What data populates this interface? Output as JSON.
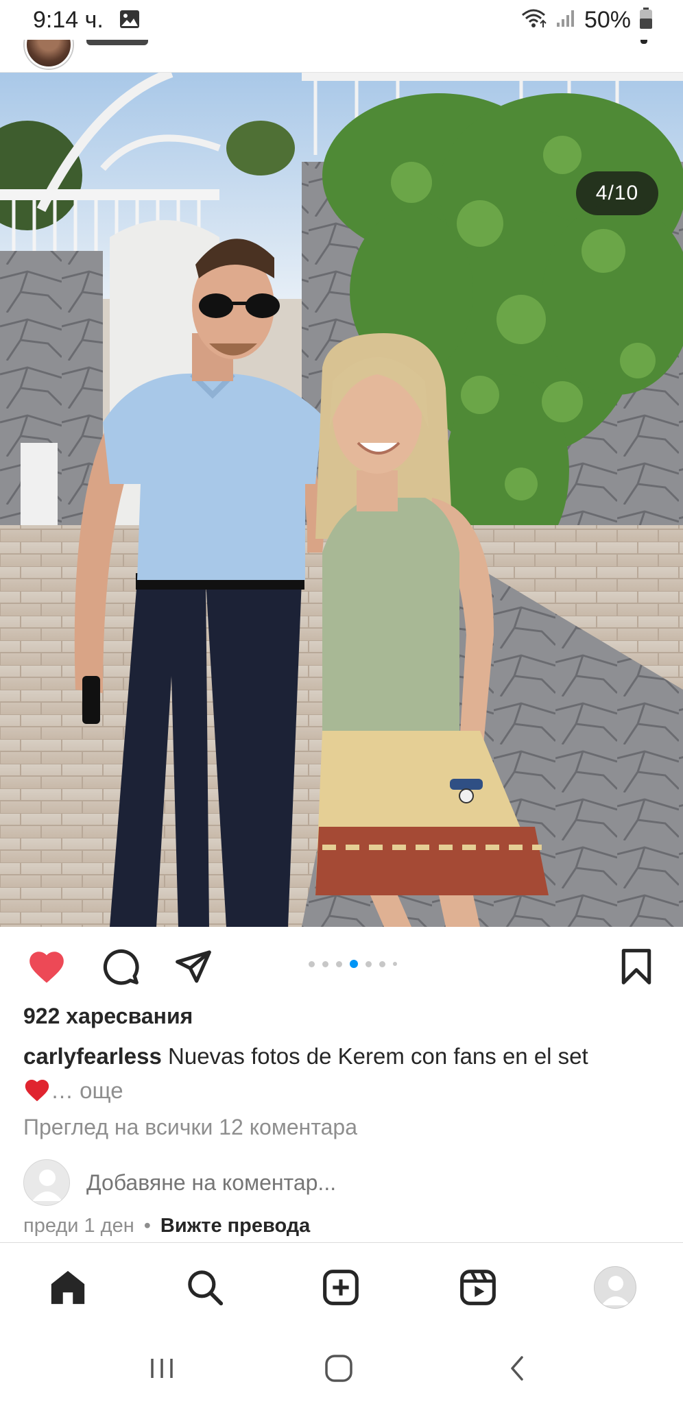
{
  "status_bar": {
    "time": "9:14 ч.",
    "battery_percent": "50%",
    "icons": [
      "gallery-icon",
      "wifi-icon",
      "signal-icon",
      "battery-icon"
    ]
  },
  "post": {
    "photo_counter": "4/10",
    "carousel": {
      "total_dots": 7,
      "active_index": 3
    },
    "likes": "922 харесвания",
    "caption_user": "carlyfearless",
    "caption_text": "Nuevas fotos de Kerem con fans en el set",
    "caption_more": "… още",
    "view_comments": "Преглед на всички 12 коментара",
    "add_comment_placeholder": "Добавяне на коментар...",
    "time_ago": "преди 1 ден",
    "separator": "•",
    "translate": "Вижте превода",
    "liked": true
  },
  "bottom_nav": {
    "items": [
      "home-icon",
      "search-icon",
      "create-icon",
      "reels-icon",
      "profile-avatar"
    ]
  },
  "system_nav": {
    "items": [
      "recent-apps-icon",
      "home-button-icon",
      "back-icon"
    ]
  },
  "colors": {
    "like_red": "#ed4956",
    "active_dot": "#0095f6",
    "muted_text": "#8e8e8e"
  }
}
